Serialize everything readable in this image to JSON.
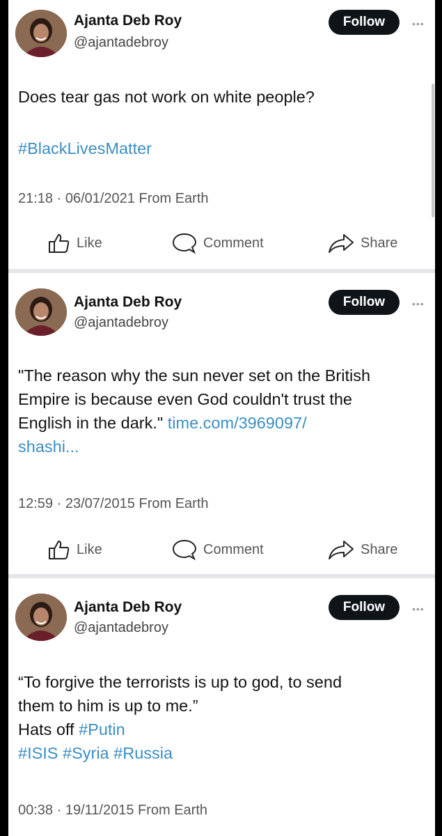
{
  "posts": [
    {
      "author": "Ajanta Deb Roy",
      "handle": "@ajantadebroy",
      "follow_label": "Follow",
      "text_lines": [
        "Does tear gas not work on white people?"
      ],
      "hashtags": [
        "#BlackLivesMatter"
      ],
      "timestamp": "21:18 · 06/01/2021 From Earth",
      "actions": {
        "like": "Like",
        "comment": "Comment",
        "share": "Share"
      }
    },
    {
      "author": "Ajanta Deb Roy",
      "handle": "@ajantadebroy",
      "follow_label": "Follow",
      "text_lines": [
        "\"The reason why the sun never set on the British",
        "Empire is because even God couldn't trust the",
        "English in the dark.\""
      ],
      "link_part1": "time.com/3969097/",
      "link_part2": "shashi...",
      "timestamp": "12:59 · 23/07/2015 From Earth",
      "actions": {
        "like": "Like",
        "comment": "Comment",
        "share": "Share"
      }
    },
    {
      "author": "Ajanta Deb Roy",
      "handle": "@ajantadebroy",
      "follow_label": "Follow",
      "text_lines": [
        "“To forgive the terrorists is up to god, to send",
        "them to him is up to me.”",
        "Hats off"
      ],
      "inline_hashtag": "#Putin",
      "hashtags": [
        "#ISIS",
        "#Syria",
        "#Russia"
      ],
      "timestamp": "00:38 · 19/11/2015 From Earth"
    }
  ],
  "icons": {
    "more": "more-dots-icon",
    "like": "thumbs-up-icon",
    "comment": "speech-bubble-icon",
    "share": "share-arrow-icon"
  },
  "colors": {
    "hashtag": "#3b8ec2",
    "follow_button": "#0f1419",
    "divider": "#e4e6ea"
  }
}
